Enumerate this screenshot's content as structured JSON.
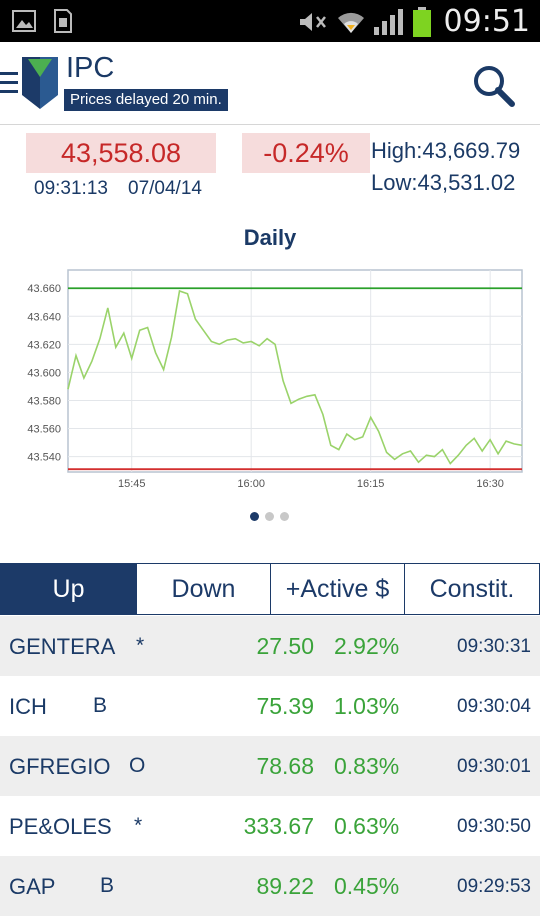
{
  "statusbar": {
    "time": "09:51",
    "icons": [
      "image-icon",
      "sim-icon",
      "mute-icon",
      "wifi-icon",
      "signal-icon",
      "battery-icon"
    ]
  },
  "header": {
    "title": "IPC",
    "delay_notice": "Prices delayed 20 min.",
    "icons": [
      "menu-icon",
      "logo",
      "search-icon"
    ]
  },
  "quote": {
    "price": "43,558.08",
    "change": "-0.24%",
    "time": "09:31:13",
    "date": "07/04/14",
    "high_label": "High:",
    "high": "43,669.79",
    "low_label": "Low:",
    "low": "43,531.02"
  },
  "chart_data": {
    "type": "line",
    "title": "Daily",
    "xlabel": "",
    "ylabel": "",
    "x_ticks": [
      "15:45",
      "16:00",
      "16:15",
      "16:30"
    ],
    "y_ticks": [
      "43.660",
      "43.640",
      "43.620",
      "43.600",
      "43.580",
      "43.560",
      "43.540"
    ],
    "ylim": [
      43.529,
      43.673
    ],
    "xlim": [
      "15:37",
      "16:34"
    ],
    "reference_lines": [
      {
        "value": 43.66,
        "color": "#2aa02a"
      },
      {
        "value": 43.531,
        "color": "#d32f2f"
      }
    ],
    "series": [
      {
        "color": "#9ad36a",
        "x": [
          "15:37",
          "15:38",
          "15:39",
          "15:40",
          "15:41",
          "15:42",
          "15:43",
          "15:44",
          "15:45",
          "15:46",
          "15:47",
          "15:48",
          "15:49",
          "15:50",
          "15:51",
          "15:52",
          "15:53",
          "15:54",
          "15:55",
          "15:56",
          "15:57",
          "15:58",
          "15:59",
          "16:00",
          "16:01",
          "16:02",
          "16:03",
          "16:04",
          "16:05",
          "16:06",
          "16:07",
          "16:08",
          "16:09",
          "16:10",
          "16:11",
          "16:12",
          "16:13",
          "16:14",
          "16:15",
          "16:16",
          "16:17",
          "16:18",
          "16:19",
          "16:20",
          "16:21",
          "16:22",
          "16:23",
          "16:24",
          "16:25",
          "16:26",
          "16:27",
          "16:28",
          "16:29",
          "16:30",
          "16:31",
          "16:32",
          "16:33",
          "16:34"
        ],
        "y": [
          43.588,
          43.612,
          43.596,
          43.608,
          43.624,
          43.646,
          43.618,
          43.628,
          43.61,
          43.63,
          43.632,
          43.614,
          43.602,
          43.625,
          43.658,
          43.656,
          43.638,
          43.63,
          43.622,
          43.62,
          43.623,
          43.624,
          43.621,
          43.622,
          43.619,
          43.624,
          43.62,
          43.594,
          43.578,
          43.581,
          43.583,
          43.584,
          43.57,
          43.548,
          43.545,
          43.556,
          43.552,
          43.554,
          43.568,
          43.558,
          43.543,
          43.538,
          43.542,
          43.544,
          43.536,
          43.541,
          43.54,
          43.545,
          43.535,
          43.541,
          43.548,
          43.553,
          43.544,
          43.552,
          43.542,
          43.551,
          43.549,
          43.548
        ]
      }
    ],
    "grid": true
  },
  "pager": {
    "count": 3,
    "active": 0
  },
  "tabs": [
    {
      "label": "Up",
      "active": true
    },
    {
      "label": "Down",
      "active": false
    },
    {
      "label": "+Active $",
      "active": false
    },
    {
      "label": "Constit.",
      "active": false
    }
  ],
  "rows": [
    {
      "issuer": "GENTERA",
      "series": "*",
      "price": "27.50",
      "change": "2.92%",
      "time": "09:30:31"
    },
    {
      "issuer": "ICH",
      "series": "B",
      "price": "75.39",
      "change": "1.03%",
      "time": "09:30:04"
    },
    {
      "issuer": "GFREGIO",
      "series": "O",
      "price": "78.68",
      "change": "0.83%",
      "time": "09:30:01"
    },
    {
      "issuer": "PE&OLES",
      "series": "*",
      "price": "333.67",
      "change": "0.63%",
      "time": "09:30:50"
    },
    {
      "issuer": "GAP",
      "series": "B",
      "price": "89.22",
      "change": "0.45%",
      "time": "09:29:53"
    }
  ],
  "colors": {
    "brand": "#1c3a68",
    "negative": "#c62828",
    "positive": "#3aa33a"
  }
}
